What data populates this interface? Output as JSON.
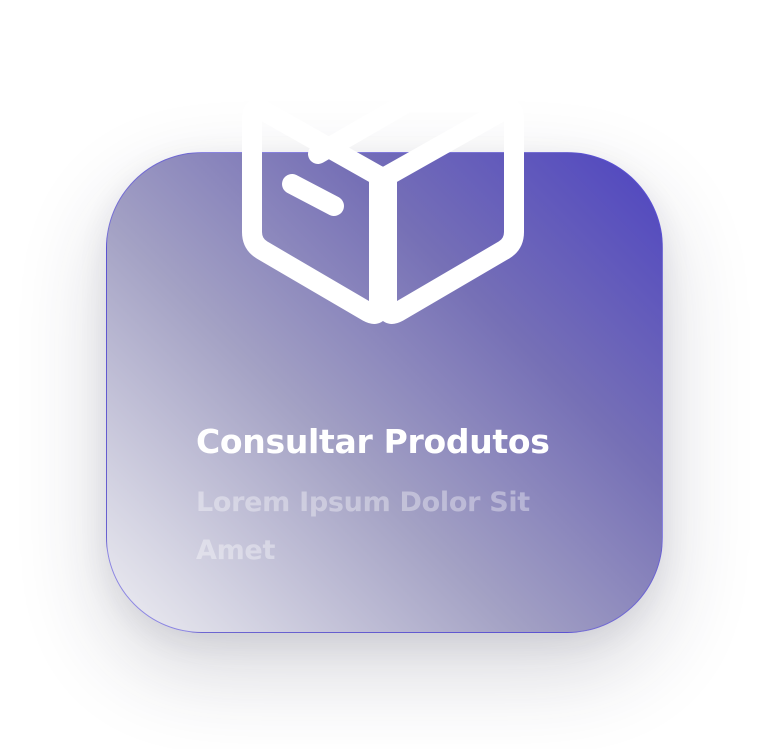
{
  "card": {
    "title": "Consultar Produtos",
    "subtitle": "Lorem Ipsum Dolor Sit Amet",
    "icon": "box-icon"
  },
  "colors": {
    "gradient_start": "#4e44c1",
    "gradient_end": "#efeff3",
    "border": "#5d54dc",
    "title_text": "#ffffff"
  }
}
